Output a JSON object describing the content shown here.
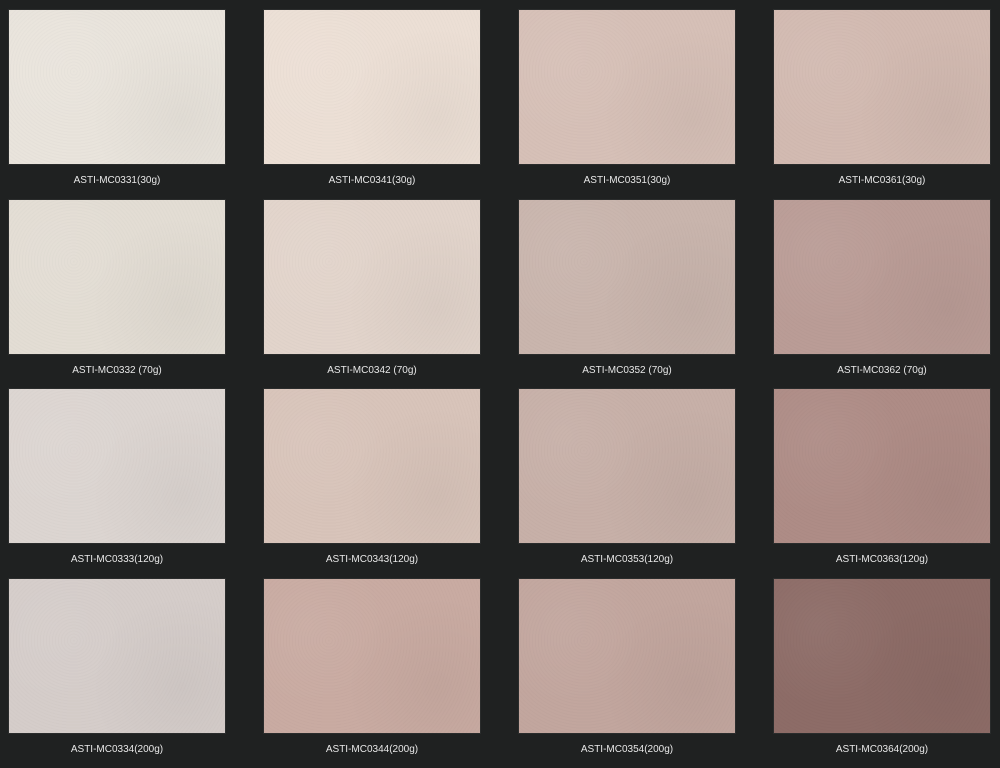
{
  "swatches": [
    [
      {
        "code": "ASTI-MC0331(30g)",
        "color": "#e9e4dc"
      },
      {
        "code": "ASTI-MC0341(30g)",
        "color": "#ecdfd5"
      },
      {
        "code": "ASTI-MC0351(30g)",
        "color": "#d6c0b7"
      },
      {
        "code": "ASTI-MC0361(30g)",
        "color": "#d2bab1"
      }
    ],
    [
      {
        "code": "ASTI-MC0332 (70g)",
        "color": "#e3ddd4"
      },
      {
        "code": "ASTI-MC0342 (70g)",
        "color": "#e2d4cb"
      },
      {
        "code": "ASTI-MC0352 (70g)",
        "color": "#c9b5ad"
      },
      {
        "code": "ASTI-MC0362 (70g)",
        "color": "#ba9c96"
      }
    ],
    [
      {
        "code": "ASTI-MC0333(120g)",
        "color": "#dcd5d1"
      },
      {
        "code": "ASTI-MC0343(120g)",
        "color": "#d8c4ba"
      },
      {
        "code": "ASTI-MC0353(120g)",
        "color": "#c7b0a8"
      },
      {
        "code": "ASTI-MC0363(120g)",
        "color": "#ae8c86"
      }
    ],
    [
      {
        "code": "ASTI-MC0334(200g)",
        "color": "#d5cdca"
      },
      {
        "code": "ASTI-MC0344(200g)",
        "color": "#c9aba2"
      },
      {
        "code": "ASTI-MC0354(200g)",
        "color": "#c2a69e"
      },
      {
        "code": "ASTI-MC0364(200g)",
        "color": "#8d6c67"
      }
    ]
  ]
}
